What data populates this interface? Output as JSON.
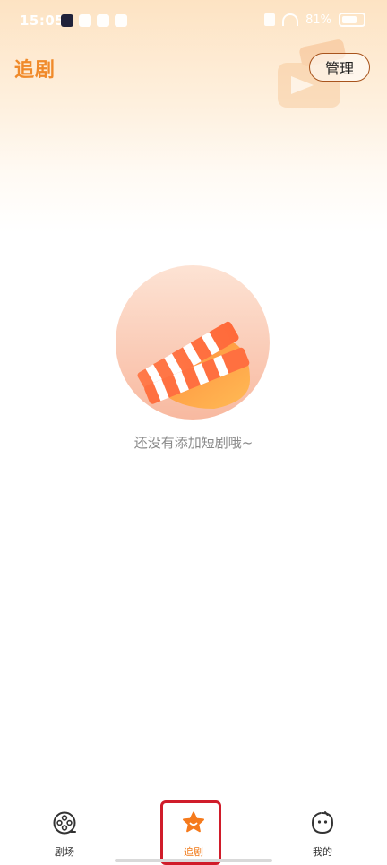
{
  "status_bar": {
    "time": "15:05",
    "battery": "81%"
  },
  "header": {
    "title": "追剧",
    "manage_label": "管理"
  },
  "empty_state": {
    "message": "还没有添加短剧哦~"
  },
  "bottom_nav": {
    "items": [
      {
        "label": "剧场",
        "icon": "film-reel-icon",
        "active": false
      },
      {
        "label": "追剧",
        "icon": "star-icon",
        "active": true
      },
      {
        "label": "我的",
        "icon": "face-icon",
        "active": false
      }
    ]
  },
  "colors": {
    "accent": "#f08a2a",
    "active_nav": "#f07a1a",
    "highlight_box": "#d01c2a",
    "manage_border": "#a8541d"
  }
}
